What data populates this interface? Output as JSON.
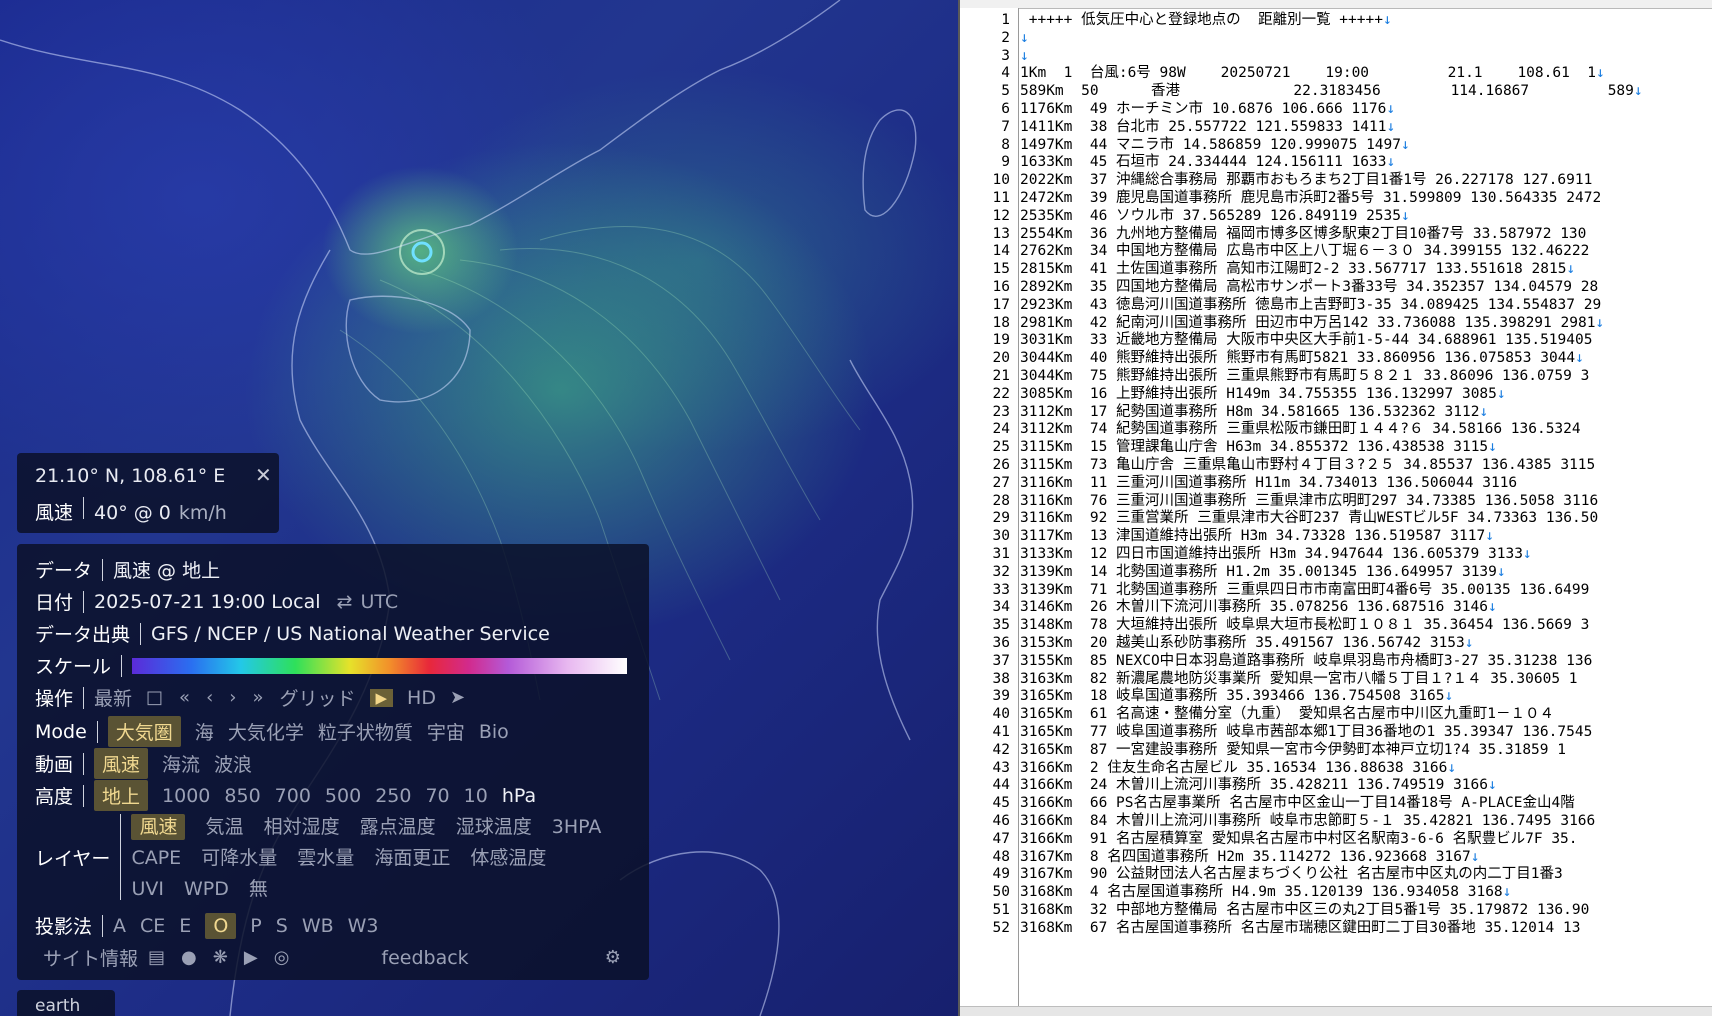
{
  "map": {
    "coord_panel": {
      "coord_text": "21.10° N, 108.61° E",
      "close_glyph": "✕",
      "field_label": "風速",
      "field_value": "40° @ 0",
      "unit": "km/h"
    },
    "menu": {
      "data": {
        "label": "データ",
        "value": "風速 @ 地上"
      },
      "date": {
        "label": "日付",
        "value": "2025-07-21 19:00 Local",
        "swap_glyph": "⇄",
        "alt": "UTC"
      },
      "source": {
        "label": "データ出典",
        "value": "GFS / NCEP / US National Weather Service"
      },
      "scale": {
        "label": "スケール"
      },
      "control": {
        "label": "操作",
        "latest": "最新",
        "calendar_icon": "□",
        "first": "«",
        "prev": "‹",
        "next": "›",
        "last": "»",
        "grid": "グリッド",
        "play_glyph": "▶",
        "hd": "HD",
        "locate_icon": "➤"
      },
      "mode": {
        "label": "Mode",
        "options": [
          "大気圏",
          "海",
          "大気化学",
          "粒子状物質",
          "宇宙",
          "Bio"
        ],
        "selected": 0
      },
      "animation": {
        "label": "動画",
        "options": [
          "風速",
          "海流",
          "波浪"
        ],
        "selected": 0
      },
      "height": {
        "label": "高度",
        "options": [
          "地上",
          "1000",
          "850",
          "700",
          "500",
          "250",
          "70",
          "10",
          "hPa"
        ],
        "selected": 0
      },
      "layer": {
        "label": "レイヤー",
        "row1": [
          "風速",
          "気温",
          "相対湿度",
          "露点温度",
          "湿球温度",
          "3HPA"
        ],
        "row2": [
          "CAPE",
          "可降水量",
          "雲水量",
          "海面更正",
          "体感温度"
        ],
        "row3": [
          "UVI",
          "WPD",
          "無"
        ],
        "selected": "風速"
      },
      "projection": {
        "label": "投影法",
        "options": [
          "A",
          "CE",
          "E",
          "O",
          "P",
          "S",
          "WB",
          "W3"
        ],
        "selected": 3
      },
      "footer": {
        "site_info": "サイト情報",
        "feedback": "feedback"
      }
    },
    "earth_tab": "earth"
  },
  "editor": {
    "lines": [
      {
        "n": "1",
        "t": " +++++ 低気圧中心と登録地点の  距離別一覧 +++++",
        "eol": true
      },
      {
        "n": "2",
        "t": "",
        "eol": true
      },
      {
        "n": "3",
        "t": "",
        "eol": true
      },
      {
        "n": "4",
        "t": "1Km  1  台風:6号 98W    20250721    19:00         21.1    108.61  1",
        "eol": true
      },
      {
        "n": "5",
        "t": "589Km  50      香港             22.3183456        114.16867         589",
        "eol": true
      },
      {
        "n": "6",
        "t": "1176Km  49 ホーチミン市 10.6876 106.666 1176",
        "eol": true
      },
      {
        "n": "7",
        "t": "1411Km  38 台北市 25.557722 121.559833 1411",
        "eol": true
      },
      {
        "n": "8",
        "t": "1497Km  44 マニラ市 14.586859 120.999075 1497",
        "eol": true
      },
      {
        "n": "9",
        "t": "1633Km  45 石垣市 24.334444 124.156111 1633",
        "eol": true
      },
      {
        "n": "10",
        "t": "2022Km  37 沖縄総合事務局 那覇市おもろまち2丁目1番1号 26.227178 127.6911",
        "eol": false
      },
      {
        "n": "11",
        "t": "2472Km  39 鹿児島国道事務所 鹿児島市浜町2番5号 31.599809 130.564335 2472",
        "eol": false
      },
      {
        "n": "12",
        "t": "2535Km  46 ソウル市 37.565289 126.849119 2535",
        "eol": true
      },
      {
        "n": "13",
        "t": "2554Km  36 九州地方整備局 福岡市博多区博多駅東2丁目10番7号 33.587972 130",
        "eol": false
      },
      {
        "n": "14",
        "t": "2762Km  34 中国地方整備局 広島市中区上八丁堀６－３０ 34.399155 132.46222",
        "eol": false
      },
      {
        "n": "15",
        "t": "2815Km  41 土佐国道事務所 高知市江陽町2-2 33.567717 133.551618 2815",
        "eol": true
      },
      {
        "n": "16",
        "t": "2892Km  35 四国地方整備局 高松市サンポート3番33号 34.352357 134.04579 28",
        "eol": false
      },
      {
        "n": "17",
        "t": "2923Km  43 徳島河川国道事務所 徳島市上吉野町3-35 34.089425 134.554837 29",
        "eol": false
      },
      {
        "n": "18",
        "t": "2981Km  42 紀南河川国道事務所 田辺市中万呂142 33.736088 135.398291 2981",
        "eol": true
      },
      {
        "n": "19",
        "t": "3031Km  33 近畿地方整備局 大阪市中央区大手前1-5-44 34.688961 135.519405",
        "eol": false
      },
      {
        "n": "20",
        "t": "3044Km  40 熊野維持出張所 熊野市有馬町5821 33.860956 136.075853 3044",
        "eol": true
      },
      {
        "n": "21",
        "t": "3044Km  75 熊野維持出張所 三重県熊野市有馬町５８２１ 33.86096 136.0759 3",
        "eol": false
      },
      {
        "n": "22",
        "t": "3085Km  16 上野維持出張所 H149m 34.755355 136.132997 3085",
        "eol": true
      },
      {
        "n": "23",
        "t": "3112Km  17 紀勢国道事務所 H8m 34.581665 136.532362 3112",
        "eol": true
      },
      {
        "n": "24",
        "t": "3112Km  74 紀勢国道事務所 三重県松阪市鎌田町１４４?６ 34.58166 136.5324",
        "eol": false
      },
      {
        "n": "25",
        "t": "3115Km  15 管理課亀山庁舎 H63m 34.855372 136.438538 3115",
        "eol": true
      },
      {
        "n": "26",
        "t": "3115Km  73 亀山庁舎 三重県亀山市野村４丁目３?２５ 34.85537 136.4385 3115",
        "eol": false
      },
      {
        "n": "27",
        "t": "3116Km  11 三重河川国道事務所 H11m 34.734013 136.506044 3116",
        "eol": false
      },
      {
        "n": "28",
        "t": "3116Km  76 三重河川国道事務所 三重県津市広明町297 34.73385 136.5058 3116",
        "eol": false
      },
      {
        "n": "29",
        "t": "3116Km  92 三重営業所 三重県津市大谷町237 青山WESTビル5F 34.73363 136.50",
        "eol": false
      },
      {
        "n": "30",
        "t": "3117Km  13 津国道維持出張所 H3m 34.73328 136.519587 3117",
        "eol": true
      },
      {
        "n": "31",
        "t": "3133Km  12 四日市国道維持出張所 H3m 34.947644 136.605379 3133",
        "eol": true
      },
      {
        "n": "32",
        "t": "3139Km  14 北勢国道事務所 H1.2m 35.001345 136.649957 3139",
        "eol": true
      },
      {
        "n": "33",
        "t": "3139Km  71 北勢国道事務所 三重県四日市市南富田町4番6号 35.00135 136.6499",
        "eol": false
      },
      {
        "n": "34",
        "t": "3146Km  26 木曽川下流河川事務所 35.078256 136.687516 3146",
        "eol": true
      },
      {
        "n": "35",
        "t": "3148Km  78 大垣維持出張所 岐阜県大垣市長松町１０８１ 35.36454 136.5669 3",
        "eol": false
      },
      {
        "n": "36",
        "t": "3153Km  20 越美山系砂防事務所 35.491567 136.56742 3153",
        "eol": true
      },
      {
        "n": "37",
        "t": "3155Km  85 NEXCO中日本羽島道路事務所 岐阜県羽島市舟橋町3-27 35.31238 136",
        "eol": false
      },
      {
        "n": "38",
        "t": "3163Km  82 新濃尾農地防災事業所 愛知県一宮市八幡５丁目１?１４ 35.30605 1",
        "eol": false
      },
      {
        "n": "39",
        "t": "3165Km  18 岐阜国道事務所 35.393466 136.754508 3165",
        "eol": true
      },
      {
        "n": "40",
        "t": "3165Km  61 名高速・整備分室（九重） 愛知県名古屋市中川区九重町1－１０４",
        "eol": false
      },
      {
        "n": "41",
        "t": "3165Km  77 岐阜国道事務所 岐阜市茜部本郷1丁目36番地の1 35.39347 136.7545",
        "eol": false
      },
      {
        "n": "42",
        "t": "3165Km  87 一宮建設事務所 愛知県一宮市今伊勢町本神戸立切1?4 35.31859 1",
        "eol": false
      },
      {
        "n": "43",
        "t": "3166Km  2 住友生命名古屋ビル 35.16534 136.88638 3166",
        "eol": true
      },
      {
        "n": "44",
        "t": "3166Km  24 木曽川上流河川事務所 35.428211 136.749519 3166",
        "eol": true
      },
      {
        "n": "45",
        "t": "3166Km  66 PS名古屋事業所 名古屋市中区金山一丁目14番18号 A-PLACE金山4階",
        "eol": false
      },
      {
        "n": "46",
        "t": "3166Km  84 木曽川上流河川事務所 岐阜市忠節町５-１ 35.42821 136.7495 3166",
        "eol": false
      },
      {
        "n": "47",
        "t": "3166Km  91 名古屋積算室 愛知県名古屋市中村区名駅南3-6-6 名駅豊ビル7F 35.",
        "eol": false
      },
      {
        "n": "48",
        "t": "3167Km  8 名四国道事務所 H2m 35.114272 136.923668 3167",
        "eol": true
      },
      {
        "n": "49",
        "t": "3167Km  90 公益財団法人名古屋まちづくり公社 名古屋市中区丸の内二丁目1番3",
        "eol": false
      },
      {
        "n": "50",
        "t": "3168Km  4 名古屋国道事務所 H4.9m 35.120139 136.934058 3168",
        "eol": true
      },
      {
        "n": "51",
        "t": "3168Km  32 中部地方整備局 名古屋市中区三の丸2丁目5番1号 35.179872 136.90",
        "eol": false
      },
      {
        "n": "52",
        "t": "3168Km  67 名古屋国道事務所 名古屋市瑞穂区鍵田町二丁目30番地 35.12014 13",
        "eol": false
      }
    ],
    "eol_glyph": "↓"
  }
}
